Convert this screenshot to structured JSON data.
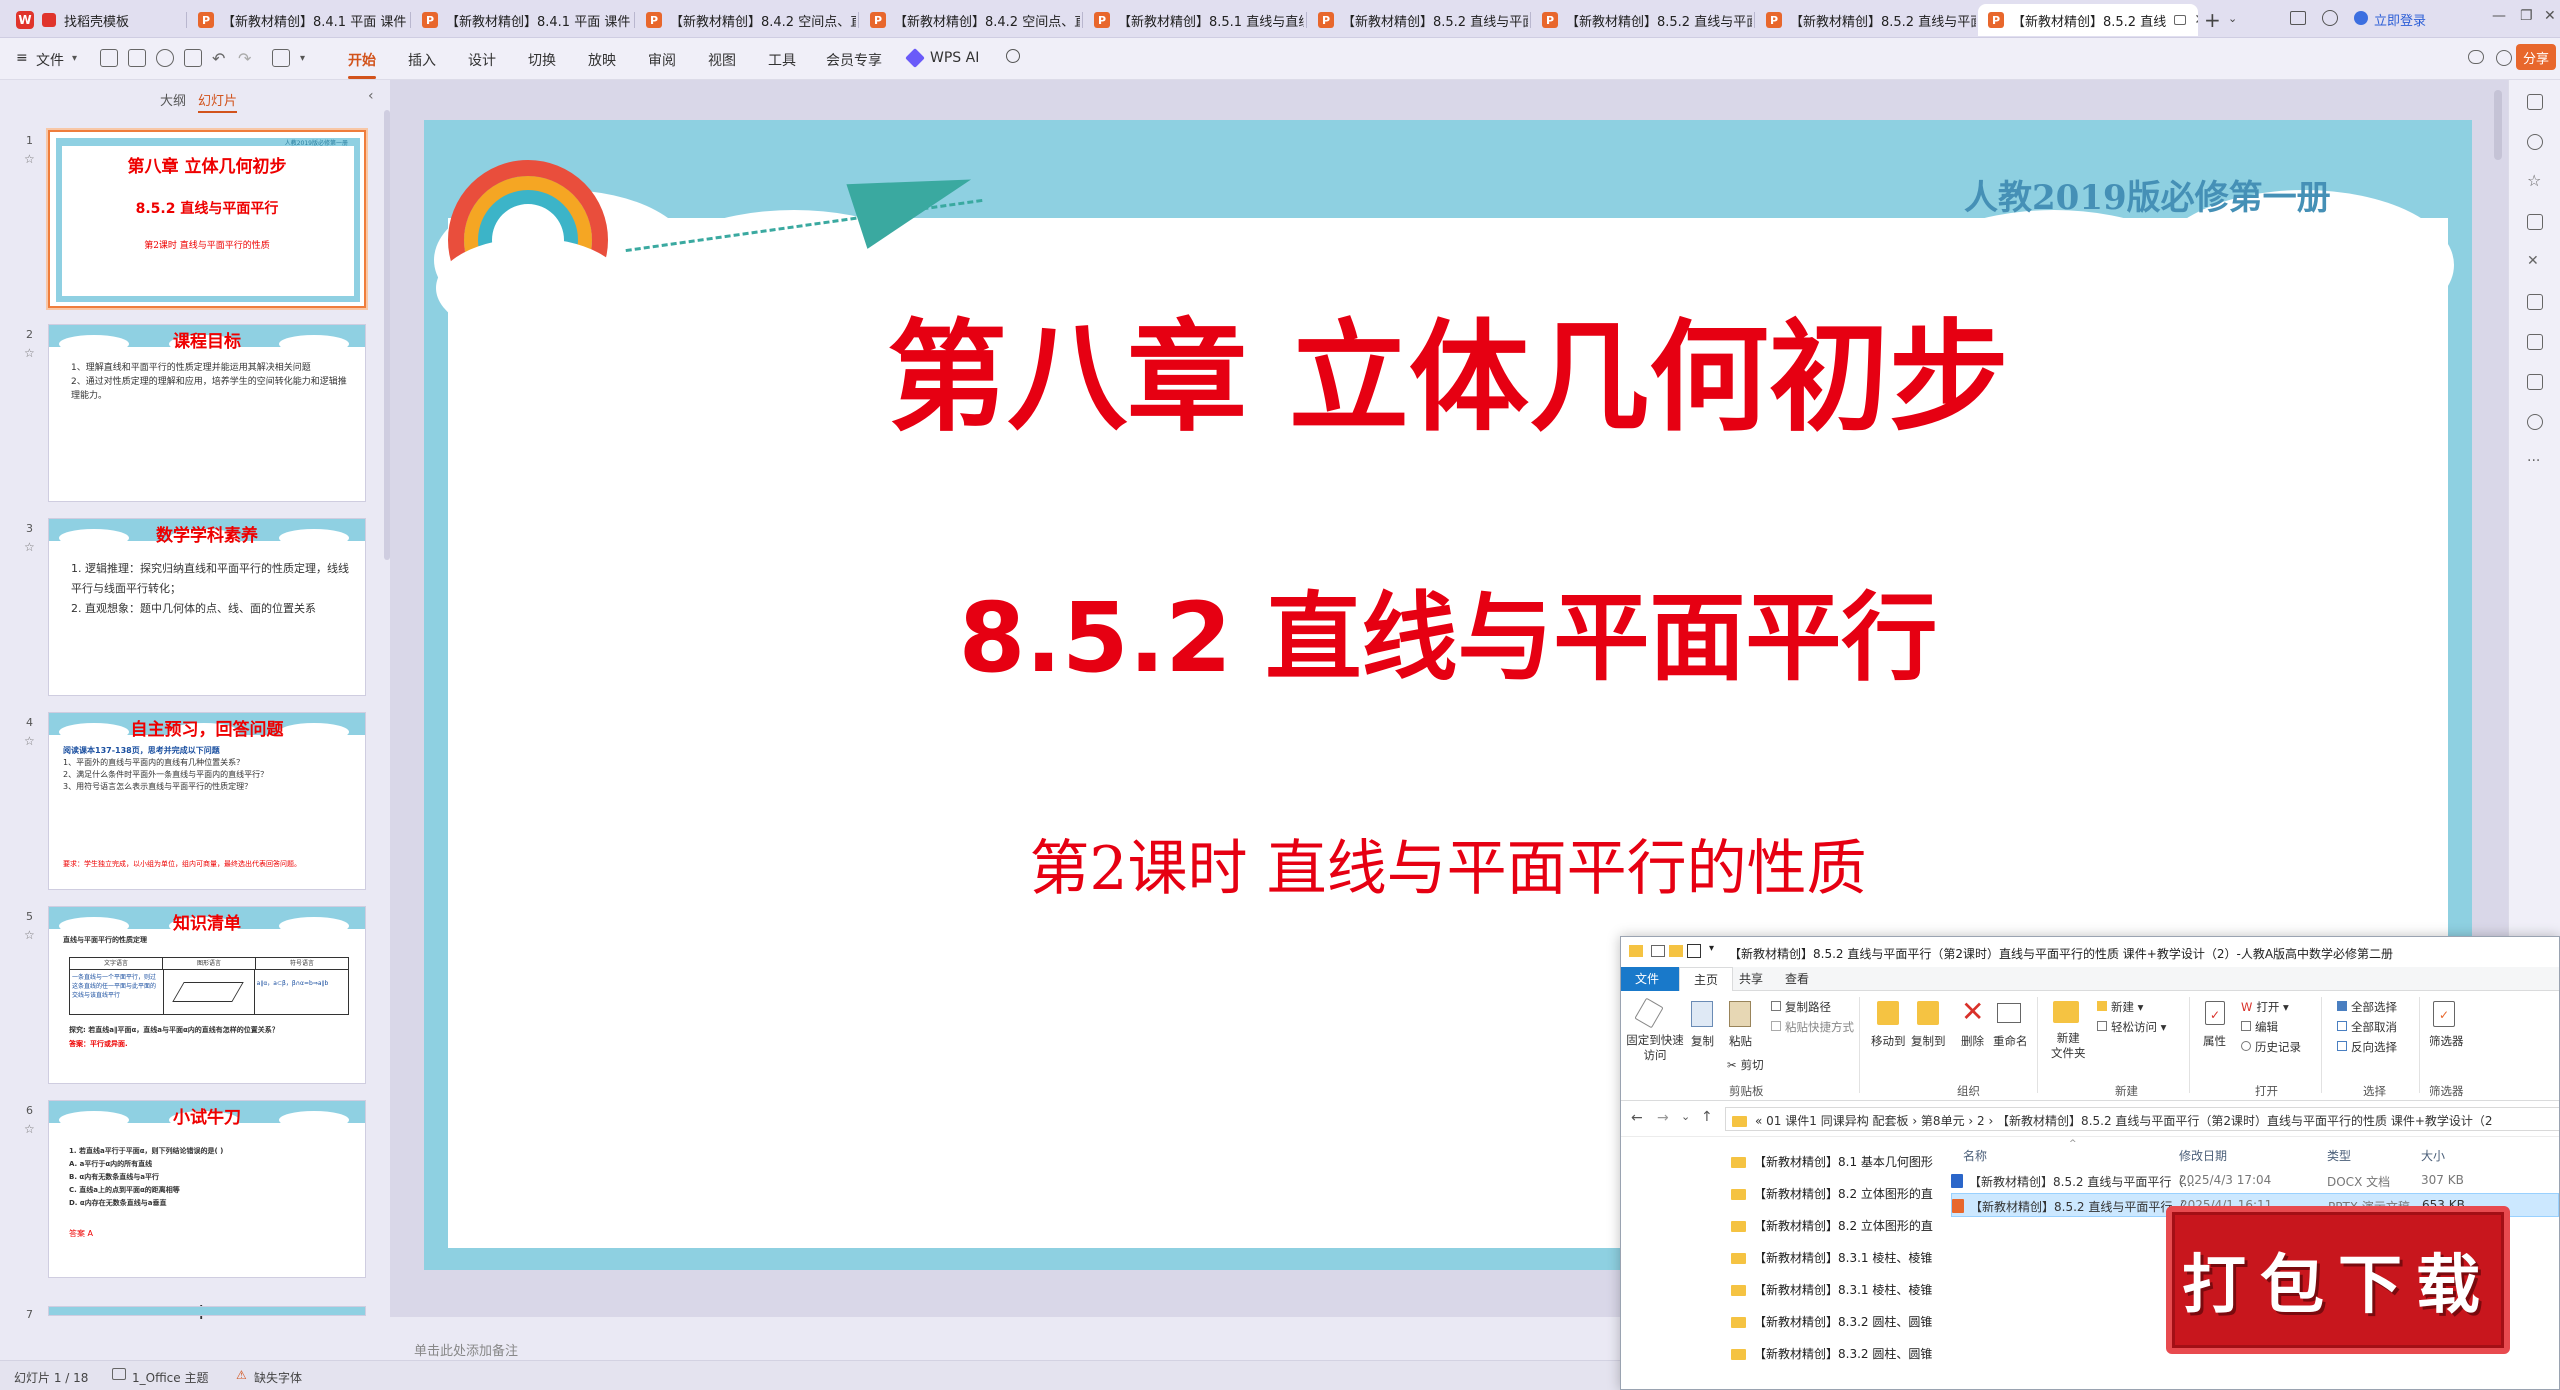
{
  "tabs": [
    {
      "label": "找稻壳模板",
      "icon": "wps-logo-icon"
    },
    {
      "label": "【新教材精创】8.4.1 平面 课件"
    },
    {
      "label": "【新教材精创】8.4.1 平面 课件"
    },
    {
      "label": "【新教材精创】8.4.2 空间点、直"
    },
    {
      "label": "【新教材精创】8.4.2 空间点、直"
    },
    {
      "label": "【新教材精创】8.5.1 直线与直线"
    },
    {
      "label": "【新教材精创】8.5.2 直线与平面"
    },
    {
      "label": "【新教材精创】8.5.2 直线与平面"
    },
    {
      "label": "【新教材精创】8.5.2 直线与平面"
    },
    {
      "label": "【新教材精创】8.5.2 直线"
    }
  ],
  "topbar": {
    "login": "立即登录",
    "share": "分享"
  },
  "menu": {
    "file": "文件",
    "items": [
      "开始",
      "插入",
      "设计",
      "切换",
      "放映",
      "审阅",
      "视图",
      "工具",
      "会员专享",
      "WPS AI"
    ]
  },
  "leftpanel": {
    "tab_outline": "大纲",
    "tab_slides": "幻灯片",
    "thumbs": [
      {
        "num": "1",
        "title": "第八章   立体几何初步",
        "sub": "8.5.2 直线与平面平行",
        "sub2": "第2课时  直线与平面平行的性质",
        "badge": "人教2019版必修第一册"
      },
      {
        "num": "2",
        "title": "课程目标",
        "lines": [
          "1、理解直线和平面平行的性质定理并能运用其解决相关问题",
          "2、通过对性质定理的理解和应用，培养学生的空间转化能力和逻辑推理能力。"
        ]
      },
      {
        "num": "3",
        "title": "数学学科素养",
        "lines": [
          "1. 逻辑推理：探究归纳直线和平面平行的性质定理，线线平行与线面平行转化；",
          "2. 直观想象：题中几何体的点、线、面的位置关系"
        ]
      },
      {
        "num": "4",
        "title": "自主预习，回答问题",
        "lines": [
          "阅读课本137-138页，思考并完成以下问题",
          "1、平面外的直线与平面内的直线有几种位置关系？",
          "2、满足什么条件时平面外一条直线与平面内的直线平行？",
          "3、用符号语言怎么表示直线与平面平行的性质定理？"
        ],
        "foot": "要求：学生独立完成，以小组为单位，组内可商量，最终选出代表回答问题。"
      },
      {
        "num": "5",
        "title": "知识清单",
        "lines": [
          "直线与平面平行的性质定理"
        ],
        "table_heads": [
          "文字语言",
          "图形语言",
          "符号语言"
        ],
        "table_text": "一条直线与一个平面平行，则过这条直线的任一平面与此平面的交线与该直线平行",
        "table_symbol": "a∥α，a⊂β，β∩α=b⇒a∥b",
        "foot": "探究: 若直线a∥平面α，直线a与平面α内的直线有怎样的位置关系？",
        "foot2": "答案：平行或异面."
      },
      {
        "num": "6",
        "title": "小试牛刀",
        "lines": [
          "1. 若直线a平行于平面α，则下列结论错误的是(      )",
          "A. a平行于α内的所有直线",
          "B. α内有无数条直线与a平行",
          "C. 直线a上的点到平面α的距离相等",
          "D. α内存在无数条直线与a垂直"
        ],
        "foot": "答案  A"
      },
      {
        "num": "7"
      }
    ]
  },
  "slide": {
    "badge": "人教2019版必修第一册",
    "title": "第八章     立体几何初步",
    "subtitle": "8.5.2 直线与平面平行",
    "lesson": "第2课时  直线与平面平行的性质"
  },
  "notes_placeholder": "单击此处添加备注",
  "status": {
    "slide_count": "幻灯片 1 / 18",
    "theme": "1_Office 主题",
    "font_warning": "缺失字体"
  },
  "explorer": {
    "title": "【新教材精创】8.5.2 直线与平面平行（第2课时）直线与平面平行的性质 课件+教学设计（2）-人教A版高中数学必修第二册",
    "tabs": [
      "文件",
      "主页",
      "共享",
      "查看"
    ],
    "ribbon": {
      "pin": "固定到快速访问",
      "copy": "复制",
      "paste": "粘贴",
      "copy_path": "复制路径",
      "paste_shortcut": "粘贴快捷方式",
      "cut": "剪切",
      "move_to": "移动到",
      "copy_to": "复制到",
      "delete": "删除",
      "rename": "重命名",
      "new_folder": "新建\n文件夹",
      "new_item": "新建",
      "easy_access": "轻松访问",
      "properties": "属性",
      "open": "打开",
      "edit": "编辑",
      "history": "历史记录",
      "select_all": "全部选择",
      "select_none": "全部取消",
      "invert": "反向选择",
      "filter": "筛选器",
      "groups": [
        "剪贴板",
        "组织",
        "新建",
        "打开",
        "选择",
        "筛选器"
      ]
    },
    "address": "«  01 课件1 同课异构 配套板  ›  第8单元  ›  2  ›  【新教材精创】8.5.2 直线与平面平行（第2课时）直线与平面平行的性质 课件+教学设计（2",
    "nav": [
      "【新教材精创】8.1 基本几何图形",
      "【新教材精创】8.2 立体图形的直",
      "【新教材精创】8.2 立体图形的直",
      "【新教材精创】8.3.1 棱柱、棱锥",
      "【新教材精创】8.3.1 棱柱、棱锥",
      "【新教材精创】8.3.2 圆柱、圆锥",
      "【新教材精创】8.3.2 圆柱、圆锥"
    ],
    "columns": [
      "名称",
      "修改日期",
      "类型",
      "大小"
    ],
    "files": [
      {
        "name": "【新教材精创】8.5.2 直线与平面平行（...",
        "date": "2025/4/3 17:04",
        "type": "DOCX 文档",
        "size": "307 KB"
      },
      {
        "name": "【新教材精创】8.5.2 直线与平面平行（...",
        "date": "2025/4/1 16:11",
        "type": "PPTX 演示文稿",
        "size": "653 KB"
      }
    ]
  },
  "download_badge": "打包下载",
  "colors": {
    "accent": "#d2531c",
    "slide_red": "#e60012",
    "slide_blue": "#8ed0e1",
    "badge_red": "#c8161d"
  }
}
